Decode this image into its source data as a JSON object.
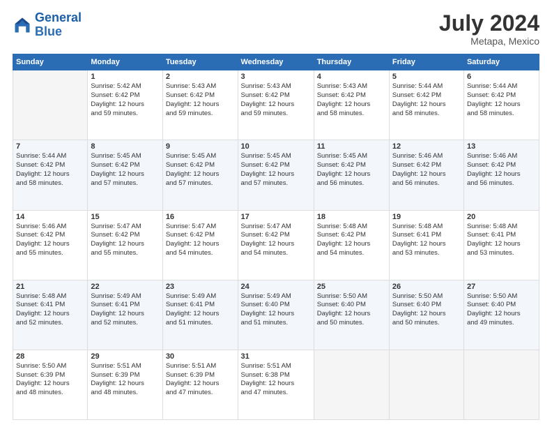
{
  "header": {
    "logo_line1": "General",
    "logo_line2": "Blue",
    "month_year": "July 2024",
    "location": "Metapa, Mexico"
  },
  "days_of_week": [
    "Sunday",
    "Monday",
    "Tuesday",
    "Wednesday",
    "Thursday",
    "Friday",
    "Saturday"
  ],
  "weeks": [
    [
      {
        "num": "",
        "info": ""
      },
      {
        "num": "1",
        "info": "Sunrise: 5:42 AM\nSunset: 6:42 PM\nDaylight: 12 hours\nand 59 minutes."
      },
      {
        "num": "2",
        "info": "Sunrise: 5:43 AM\nSunset: 6:42 PM\nDaylight: 12 hours\nand 59 minutes."
      },
      {
        "num": "3",
        "info": "Sunrise: 5:43 AM\nSunset: 6:42 PM\nDaylight: 12 hours\nand 59 minutes."
      },
      {
        "num": "4",
        "info": "Sunrise: 5:43 AM\nSunset: 6:42 PM\nDaylight: 12 hours\nand 58 minutes."
      },
      {
        "num": "5",
        "info": "Sunrise: 5:44 AM\nSunset: 6:42 PM\nDaylight: 12 hours\nand 58 minutes."
      },
      {
        "num": "6",
        "info": "Sunrise: 5:44 AM\nSunset: 6:42 PM\nDaylight: 12 hours\nand 58 minutes."
      }
    ],
    [
      {
        "num": "7",
        "info": "Sunrise: 5:44 AM\nSunset: 6:42 PM\nDaylight: 12 hours\nand 58 minutes."
      },
      {
        "num": "8",
        "info": "Sunrise: 5:45 AM\nSunset: 6:42 PM\nDaylight: 12 hours\nand 57 minutes."
      },
      {
        "num": "9",
        "info": "Sunrise: 5:45 AM\nSunset: 6:42 PM\nDaylight: 12 hours\nand 57 minutes."
      },
      {
        "num": "10",
        "info": "Sunrise: 5:45 AM\nSunset: 6:42 PM\nDaylight: 12 hours\nand 57 minutes."
      },
      {
        "num": "11",
        "info": "Sunrise: 5:45 AM\nSunset: 6:42 PM\nDaylight: 12 hours\nand 56 minutes."
      },
      {
        "num": "12",
        "info": "Sunrise: 5:46 AM\nSunset: 6:42 PM\nDaylight: 12 hours\nand 56 minutes."
      },
      {
        "num": "13",
        "info": "Sunrise: 5:46 AM\nSunset: 6:42 PM\nDaylight: 12 hours\nand 56 minutes."
      }
    ],
    [
      {
        "num": "14",
        "info": "Sunrise: 5:46 AM\nSunset: 6:42 PM\nDaylight: 12 hours\nand 55 minutes."
      },
      {
        "num": "15",
        "info": "Sunrise: 5:47 AM\nSunset: 6:42 PM\nDaylight: 12 hours\nand 55 minutes."
      },
      {
        "num": "16",
        "info": "Sunrise: 5:47 AM\nSunset: 6:42 PM\nDaylight: 12 hours\nand 54 minutes."
      },
      {
        "num": "17",
        "info": "Sunrise: 5:47 AM\nSunset: 6:42 PM\nDaylight: 12 hours\nand 54 minutes."
      },
      {
        "num": "18",
        "info": "Sunrise: 5:48 AM\nSunset: 6:42 PM\nDaylight: 12 hours\nand 54 minutes."
      },
      {
        "num": "19",
        "info": "Sunrise: 5:48 AM\nSunset: 6:41 PM\nDaylight: 12 hours\nand 53 minutes."
      },
      {
        "num": "20",
        "info": "Sunrise: 5:48 AM\nSunset: 6:41 PM\nDaylight: 12 hours\nand 53 minutes."
      }
    ],
    [
      {
        "num": "21",
        "info": "Sunrise: 5:48 AM\nSunset: 6:41 PM\nDaylight: 12 hours\nand 52 minutes."
      },
      {
        "num": "22",
        "info": "Sunrise: 5:49 AM\nSunset: 6:41 PM\nDaylight: 12 hours\nand 52 minutes."
      },
      {
        "num": "23",
        "info": "Sunrise: 5:49 AM\nSunset: 6:41 PM\nDaylight: 12 hours\nand 51 minutes."
      },
      {
        "num": "24",
        "info": "Sunrise: 5:49 AM\nSunset: 6:40 PM\nDaylight: 12 hours\nand 51 minutes."
      },
      {
        "num": "25",
        "info": "Sunrise: 5:50 AM\nSunset: 6:40 PM\nDaylight: 12 hours\nand 50 minutes."
      },
      {
        "num": "26",
        "info": "Sunrise: 5:50 AM\nSunset: 6:40 PM\nDaylight: 12 hours\nand 50 minutes."
      },
      {
        "num": "27",
        "info": "Sunrise: 5:50 AM\nSunset: 6:40 PM\nDaylight: 12 hours\nand 49 minutes."
      }
    ],
    [
      {
        "num": "28",
        "info": "Sunrise: 5:50 AM\nSunset: 6:39 PM\nDaylight: 12 hours\nand 48 minutes."
      },
      {
        "num": "29",
        "info": "Sunrise: 5:51 AM\nSunset: 6:39 PM\nDaylight: 12 hours\nand 48 minutes."
      },
      {
        "num": "30",
        "info": "Sunrise: 5:51 AM\nSunset: 6:39 PM\nDaylight: 12 hours\nand 47 minutes."
      },
      {
        "num": "31",
        "info": "Sunrise: 5:51 AM\nSunset: 6:38 PM\nDaylight: 12 hours\nand 47 minutes."
      },
      {
        "num": "",
        "info": ""
      },
      {
        "num": "",
        "info": ""
      },
      {
        "num": "",
        "info": ""
      }
    ]
  ]
}
